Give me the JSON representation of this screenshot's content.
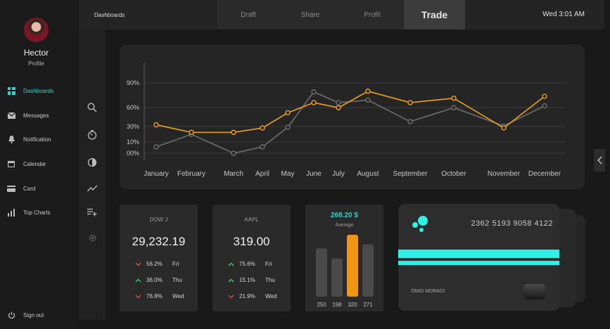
{
  "profile": {
    "name": "Hector",
    "role": "Profile"
  },
  "sidebar": {
    "items": [
      {
        "label": "Dashboards",
        "icon": "dashboard-icon",
        "active": true
      },
      {
        "label": "Messages",
        "icon": "envelope-icon"
      },
      {
        "label": "Notification",
        "icon": "bell-icon"
      },
      {
        "label": "Calendar",
        "icon": "calendar-icon"
      },
      {
        "label": "Card",
        "icon": "credit-card-icon"
      },
      {
        "label": "Top Charts",
        "icon": "bar-chart-icon"
      }
    ],
    "signout": "Sign out"
  },
  "rail": {
    "icons": [
      "search-icon",
      "timer-icon",
      "half-circle-icon",
      "trend-icon",
      "playlist-add-icon",
      "settings-icon"
    ]
  },
  "header": {
    "breadcrumb": "Dashboards",
    "tabs": [
      {
        "label": "Draft"
      },
      {
        "label": "Share"
      },
      {
        "label": "Profit"
      },
      {
        "label": "Trade",
        "active": true
      }
    ],
    "clock": "Wed 3:01 AM"
  },
  "chart_data": {
    "type": "line",
    "categories": [
      "January",
      "February",
      "March",
      "April",
      "May",
      "June",
      "July",
      "August",
      "September",
      "October",
      "November",
      "December"
    ],
    "y_ticks": [
      "00%",
      "10%",
      "30%",
      "60%",
      "90%"
    ],
    "series": [
      {
        "color": "#e59a22",
        "values": [
          45,
          33,
          33,
          40,
          64,
          80,
          72,
          98,
          80,
          87,
          40,
          90
        ]
      },
      {
        "color": "#6b6b6b",
        "values": [
          10,
          30,
          0,
          10,
          41,
          97,
          80,
          84,
          50,
          72,
          43,
          75
        ]
      }
    ],
    "grid": true
  },
  "stocks": [
    {
      "symbol": "DOW J",
      "price": "29,232.19",
      "rows": [
        {
          "dir": "down",
          "pct": "56.2%",
          "day": "Fri"
        },
        {
          "dir": "up",
          "pct": "36.0%",
          "day": "Thu"
        },
        {
          "dir": "down",
          "pct": "76.8%",
          "day": "Wed"
        }
      ]
    },
    {
      "symbol": "AAPL",
      "price": "319.00",
      "rows": [
        {
          "dir": "up",
          "pct": "75.6%",
          "day": "Fri"
        },
        {
          "dir": "up",
          "pct": "15.1%",
          "day": "Thu"
        },
        {
          "dir": "down",
          "pct": "21.9%",
          "day": "Wed"
        }
      ]
    }
  ],
  "average": {
    "value": "268.20 $",
    "label": "Average",
    "bars": [
      {
        "label": "250",
        "value": 250
      },
      {
        "label": "198",
        "value": 198
      },
      {
        "label": "320",
        "value": 320,
        "highlight": true
      },
      {
        "label": "271",
        "value": 271
      }
    ]
  },
  "card": {
    "number": "2362 5193 9058 4122",
    "holder": "OMID MORADI"
  },
  "colors": {
    "accent": "#2ed8d0",
    "orange": "#f0960f",
    "up": "#2fd27a",
    "down": "#e04a3f"
  }
}
